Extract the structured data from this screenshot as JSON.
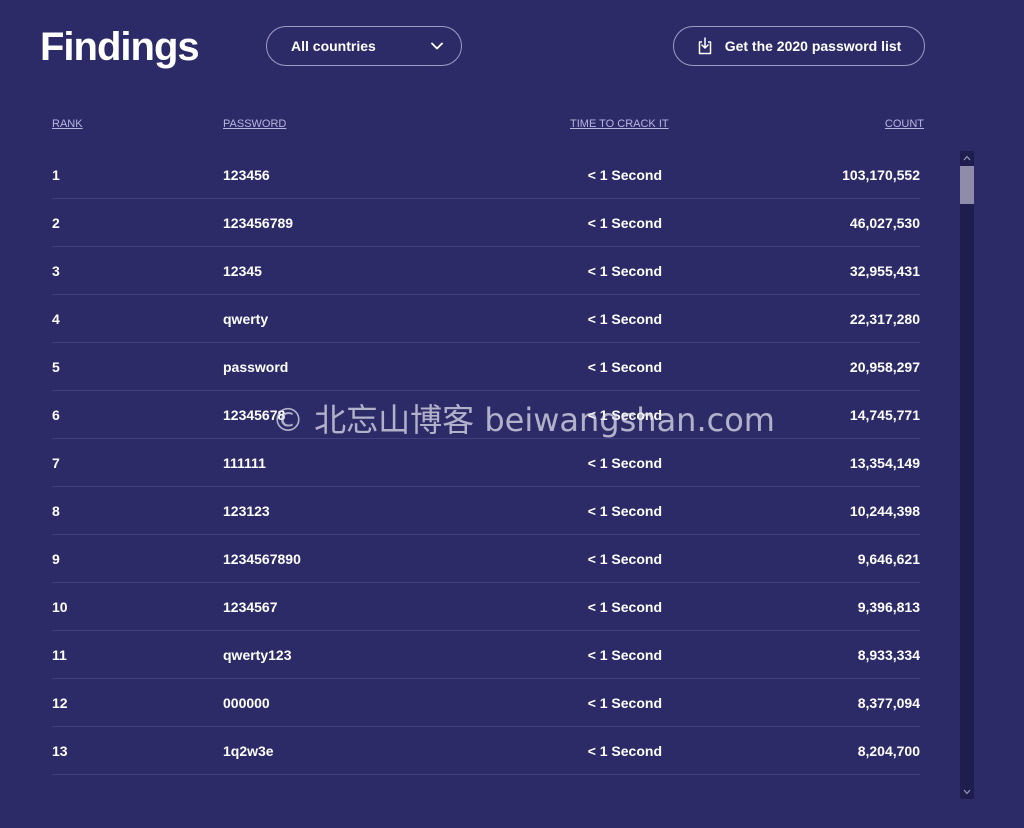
{
  "header": {
    "title": "Findings",
    "country_select": "All countries",
    "download_label": "Get the 2020 password list"
  },
  "table": {
    "columns": [
      "RANK",
      "PASSWORD",
      "TIME TO CRACK IT",
      "COUNT"
    ],
    "rows": [
      {
        "rank": "1",
        "password": "123456",
        "time": "< 1 Second",
        "count": "103,170,552"
      },
      {
        "rank": "2",
        "password": "123456789",
        "time": "< 1 Second",
        "count": "46,027,530"
      },
      {
        "rank": "3",
        "password": "12345",
        "time": "< 1 Second",
        "count": "32,955,431"
      },
      {
        "rank": "4",
        "password": "qwerty",
        "time": "< 1 Second",
        "count": "22,317,280"
      },
      {
        "rank": "5",
        "password": "password",
        "time": "< 1 Second",
        "count": "20,958,297"
      },
      {
        "rank": "6",
        "password": "12345678",
        "time": "< 1 Second",
        "count": "14,745,771"
      },
      {
        "rank": "7",
        "password": "111111",
        "time": "< 1 Second",
        "count": "13,354,149"
      },
      {
        "rank": "8",
        "password": "123123",
        "time": "< 1 Second",
        "count": "10,244,398"
      },
      {
        "rank": "9",
        "password": "1234567890",
        "time": "< 1 Second",
        "count": "9,646,621"
      },
      {
        "rank": "10",
        "password": "1234567",
        "time": "< 1 Second",
        "count": "9,396,813"
      },
      {
        "rank": "11",
        "password": "qwerty123",
        "time": "< 1 Second",
        "count": "8,933,334"
      },
      {
        "rank": "12",
        "password": "000000",
        "time": "< 1 Second",
        "count": "8,377,094"
      },
      {
        "rank": "13",
        "password": "1q2w3e",
        "time": "< 1 Second",
        "count": "8,204,700"
      }
    ]
  },
  "watermark": "© 北忘山博客 beiwangshan.com",
  "icons": {
    "dropdown": "chevron-down-icon",
    "download": "download-icon"
  },
  "colors": {
    "background": "#2d2a68",
    "text": "#ffffff",
    "header_text": "#b7b5e0",
    "divider": "#423f7e"
  }
}
